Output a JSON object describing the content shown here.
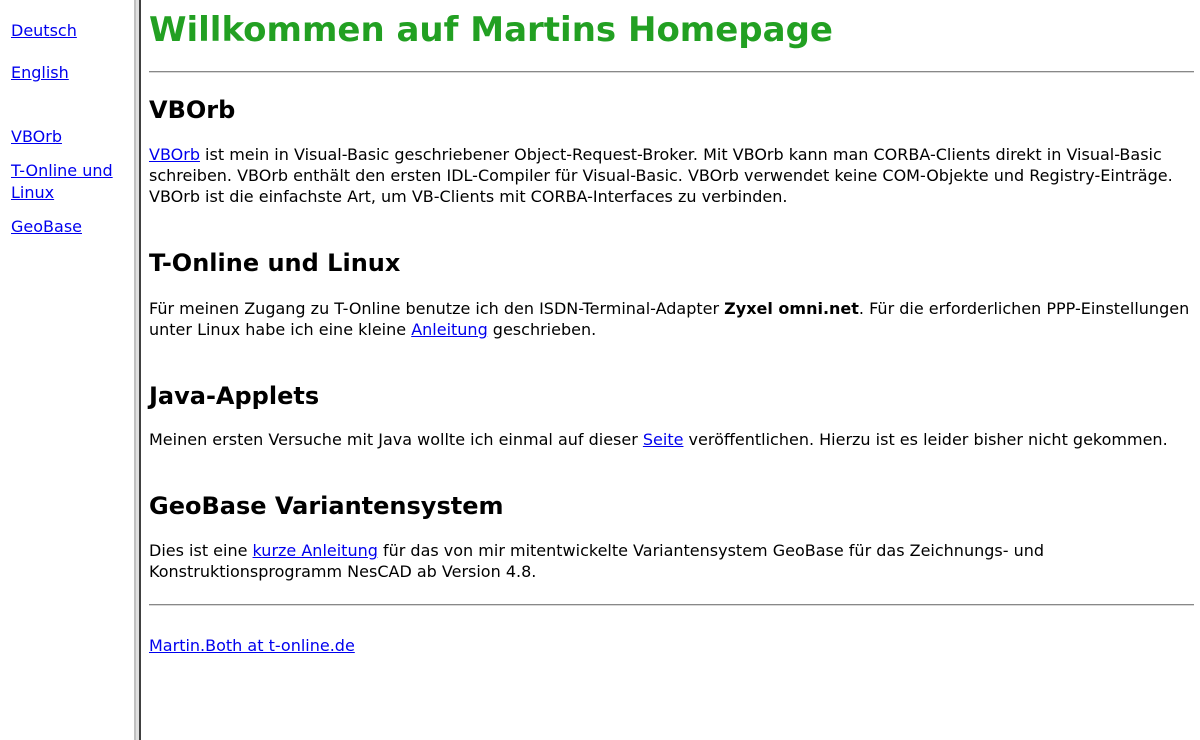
{
  "nav": {
    "deutsch": "Deutsch",
    "english": "English",
    "vborb": "VBOrb",
    "tonline": "T-Online und Linux",
    "geobase": "GeoBase"
  },
  "page": {
    "title": "Willkommen auf Martins Homepage"
  },
  "sections": {
    "vborb": {
      "title": "VBOrb",
      "link": "VBOrb",
      "text": " ist mein in Visual-Basic geschriebener Object-Request-Broker. Mit VBOrb kann man CORBA-Clients direkt in Visual-Basic schreiben. VBOrb enthält den ersten IDL-Compiler für Visual-Basic. VBOrb verwendet keine COM-Objekte und Registry-Einträge. VBOrb ist die einfachste Art, um VB-Clients mit CORBA-Interfaces zu verbinden."
    },
    "tonline": {
      "title": "T-Online und Linux",
      "text_before": "Für meinen Zugang zu T-Online benutze ich den ISDN-Terminal-Adapter ",
      "bold": "Zyxel omni.net",
      "text_middle": ". Für die erforderlichen PPP-Einstellungen unter Linux habe ich eine kleine ",
      "link": "Anleitung",
      "text_after": " geschrieben."
    },
    "java": {
      "title": "Java-Applets",
      "text_before": "Meinen ersten Versuche mit Java wollte ich einmal auf dieser ",
      "link": "Seite",
      "text_after": " veröffentlichen. Hierzu ist es leider bisher nicht gekommen."
    },
    "geobase": {
      "title": "GeoBase Variantensystem",
      "text_before": "Dies ist eine ",
      "link": "kurze Anleitung",
      "text_after": " für das von mir mitentwickelte Variantensystem GeoBase für das Zeichnungs- und Konstruktionsprogramm NesCAD ab Version 4.8."
    }
  },
  "footer": {
    "contact": "Martin.Both at t-online.de"
  },
  "colors": {
    "title": "#22a022",
    "link": "#0000ee"
  }
}
